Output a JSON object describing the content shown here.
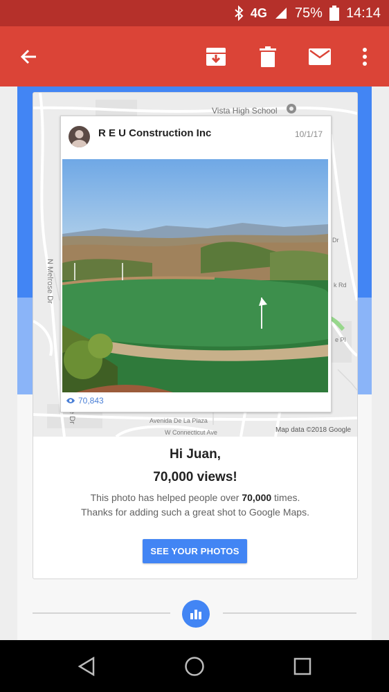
{
  "status_bar": {
    "network": "4G",
    "battery": "75%",
    "time": "14:14",
    "icons": [
      "bluetooth-icon",
      "signal-icon",
      "battery-icon"
    ]
  },
  "app_bar": {
    "icons": [
      "back-arrow-icon",
      "archive-icon",
      "trash-icon",
      "mail-icon",
      "more-vert-icon"
    ]
  },
  "map": {
    "labels": {
      "school": "Vista High School",
      "street_left": "N Melrose Dr",
      "street_left2": "e Dr",
      "avenida": "Avenida De La Plaza",
      "connecticut": "W Connecticut Ave",
      "rd": "k Rd",
      "dr": "Dr",
      "pl": "e Pl",
      "attribution": "Map data ©2018 Google"
    }
  },
  "post": {
    "business_name": "R E U Construction Inc",
    "date": "10/1/17",
    "views": "70,843"
  },
  "message": {
    "greeting": "Hi Juan,",
    "headline": "70,000 views!",
    "body_before": "This photo has helped people over ",
    "body_bold": "70,000",
    "body_after": " times. Thanks for adding such a great shot to Google Maps.",
    "button": "SEE YOUR PHOTOS"
  },
  "nav_bar": {
    "icons": [
      "back-triangle-icon",
      "home-circle-icon",
      "recents-square-icon"
    ]
  },
  "colors": {
    "status_bar": "#b5302a",
    "app_bar": "#db4437",
    "accent": "#4285f4"
  }
}
